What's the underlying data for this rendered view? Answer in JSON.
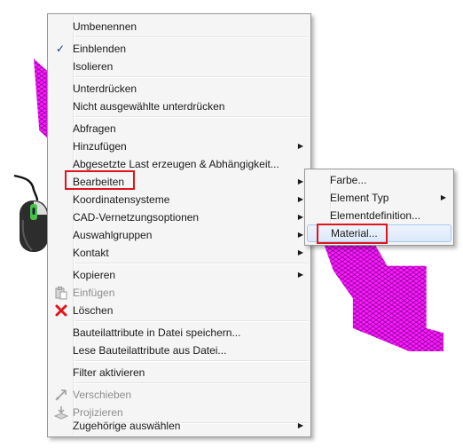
{
  "main_menu": {
    "items": [
      {
        "label": "Umbenennen"
      },
      {
        "label": "Einblenden",
        "checked": true
      },
      {
        "label": "Isolieren"
      },
      {
        "label": "Unterdrücken"
      },
      {
        "label": "Nicht ausgewählte unterdrücken"
      },
      {
        "label": "Abfragen"
      },
      {
        "label": "Hinzufügen",
        "submenu": true
      },
      {
        "label": "Abgesetzte Last erzeugen & Abhängigkeit..."
      },
      {
        "label": "Bearbeiten",
        "submenu": true,
        "highlighted": true
      },
      {
        "label": "Koordinatensysteme",
        "submenu": true
      },
      {
        "label": "CAD-Vernetzungsoptionen",
        "submenu": true
      },
      {
        "label": "Auswahlgruppen",
        "submenu": true
      },
      {
        "label": "Kontakt",
        "submenu": true
      },
      {
        "label": "Kopieren",
        "submenu": true
      },
      {
        "label": "Einfügen",
        "disabled": true,
        "icon": "paste-icon"
      },
      {
        "label": "Löschen",
        "icon": "delete-x-icon"
      },
      {
        "label": "Bauteilattribute in Datei speichern..."
      },
      {
        "label": "Lese Bauteilattribute aus Datei..."
      },
      {
        "label": "Filter aktivieren"
      },
      {
        "label": "Verschieben",
        "disabled": true,
        "icon": "move-icon"
      },
      {
        "label": "Projizieren",
        "disabled": true,
        "icon": "project-icon"
      },
      {
        "label": "Zugehörige auswählen",
        "submenu": true
      }
    ]
  },
  "sub_menu": {
    "items": [
      {
        "label": "Farbe..."
      },
      {
        "label": "Element Typ",
        "submenu": true
      },
      {
        "label": "Elementdefinition..."
      },
      {
        "label": "Material...",
        "highlighted": true
      }
    ]
  },
  "colors": {
    "mesh_fill": "#ff1aff",
    "highlight_box": "#e0151c",
    "menu_bg": "#f5f5f5"
  },
  "glyphs": {
    "submenu_arrow": "▶",
    "check": "✓"
  }
}
